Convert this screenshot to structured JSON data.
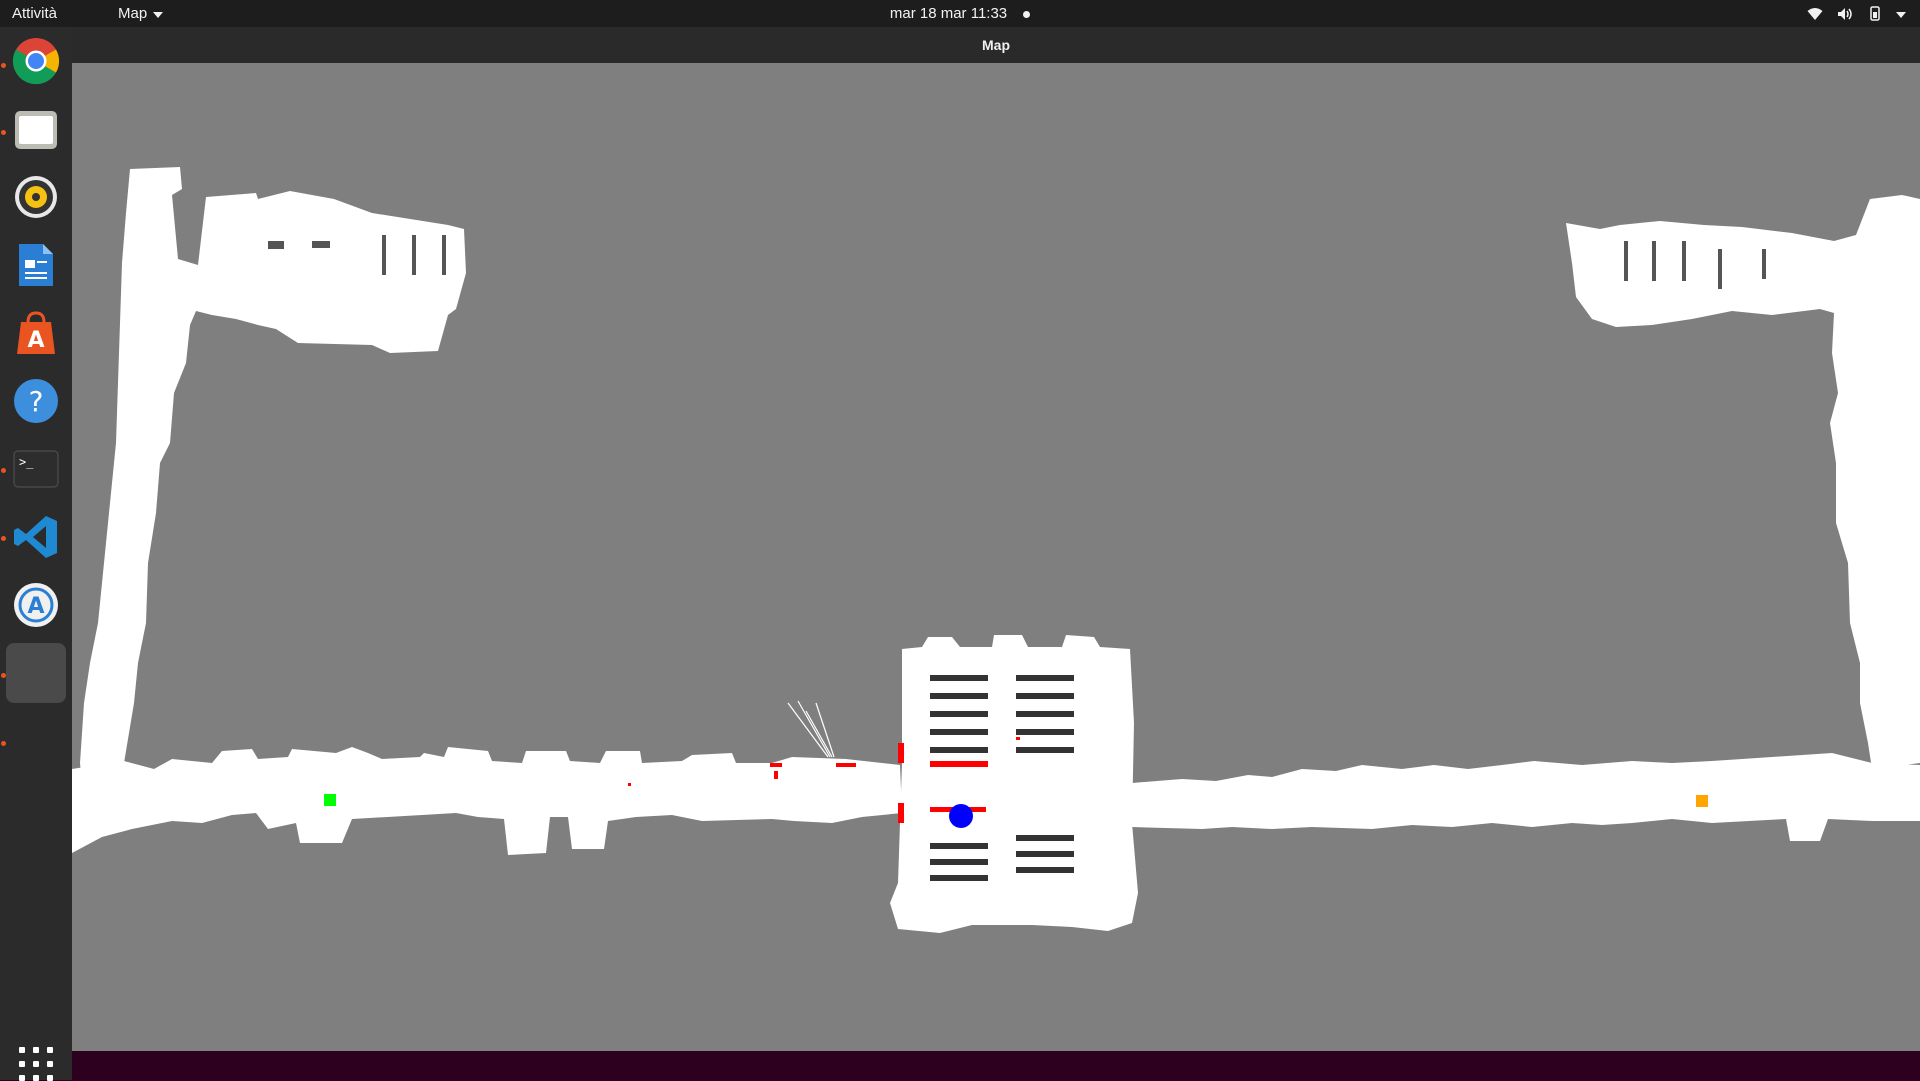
{
  "topbar": {
    "activities": "Attività",
    "app_menu": "Map",
    "clock": "mar 18 mar  11:33"
  },
  "dock": {
    "apps": [
      {
        "name": "Google Chrome",
        "icon": "chrome-icon",
        "running": true
      },
      {
        "name": "Files",
        "icon": "files-icon",
        "running": true
      },
      {
        "name": "Rhythmbox",
        "icon": "rhythmbox-icon",
        "running": false
      },
      {
        "name": "LibreOffice Writer",
        "icon": "writer-icon",
        "running": false
      },
      {
        "name": "Ubuntu Software",
        "icon": "software-center-icon",
        "running": false
      },
      {
        "name": "Help",
        "icon": "help-icon",
        "running": false
      },
      {
        "name": "Terminal",
        "icon": "terminal-icon",
        "running": true
      },
      {
        "name": "Visual Studio Code",
        "icon": "vscode-icon",
        "running": true
      },
      {
        "name": "Software Updater",
        "icon": "software-updater-icon",
        "running": false
      },
      {
        "name": "Map",
        "icon": "map-window",
        "running": true,
        "active": true
      }
    ],
    "show_apps_icon": "grid-icon"
  },
  "window": {
    "title": "Map"
  },
  "map": {
    "background_color": "#7f7f7f",
    "free_space_color": "#ffffff",
    "robot_color": "#0000ff",
    "start_marker_color": "#00ff00",
    "goal_marker_color": "#ffa500",
    "obstacle_color": "#ff0000"
  }
}
